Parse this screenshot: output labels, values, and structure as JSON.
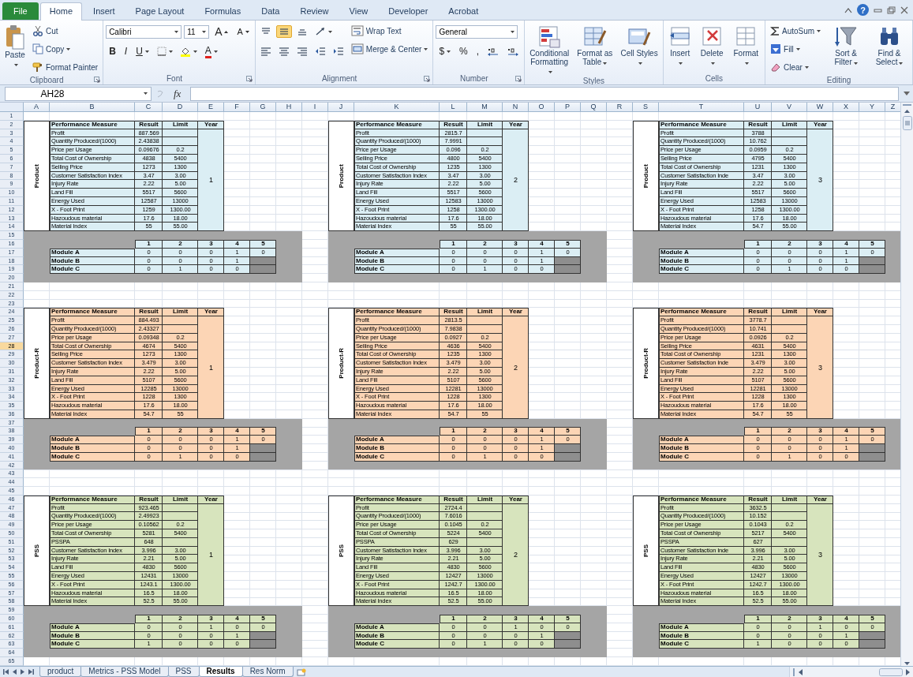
{
  "ribbon_tabs": [
    {
      "label": "File",
      "kind": "file",
      "selected": false
    },
    {
      "label": "Home",
      "kind": "tab",
      "selected": true
    },
    {
      "label": "Insert",
      "kind": "tab",
      "selected": false
    },
    {
      "label": "Page Layout",
      "kind": "tab",
      "selected": false
    },
    {
      "label": "Formulas",
      "kind": "tab",
      "selected": false
    },
    {
      "label": "Data",
      "kind": "tab",
      "selected": false
    },
    {
      "label": "Review",
      "kind": "tab",
      "selected": false
    },
    {
      "label": "View",
      "kind": "tab",
      "selected": false
    },
    {
      "label": "Developer",
      "kind": "tab",
      "selected": false
    },
    {
      "label": "Acrobat",
      "kind": "tab",
      "selected": false
    }
  ],
  "window_controls": {
    "help": "?"
  },
  "ribbon": {
    "groups": [
      {
        "label": "Clipboard",
        "launcher": true,
        "columns": [
          [
            {
              "kind": "large",
              "label": "Paste",
              "dropdown": true
            }
          ],
          [
            {
              "kind": "small",
              "label": "Cut",
              "dropdown": false
            },
            {
              "kind": "small",
              "label": "Copy",
              "dropdown": true
            },
            {
              "kind": "small",
              "label": "Format Painter",
              "dropdown": false
            }
          ]
        ]
      },
      {
        "label": "Font",
        "launcher": true,
        "columns": [
          [
            {
              "kind": "row",
              "items": [
                {
                  "kind": "font-combo",
                  "value": "Calibri"
                },
                {
                  "kind": "size-combo",
                  "value": "11"
                },
                {
                  "kind": "grow",
                  "label": "A"
                },
                {
                  "kind": "shrink",
                  "label": "A"
                }
              ]
            },
            {
              "kind": "row",
              "items": [
                {
                  "kind": "bold",
                  "label": "B",
                  "dropdown": false
                },
                {
                  "kind": "italic",
                  "label": "I",
                  "dropdown": false
                },
                {
                  "kind": "underline",
                  "label": "U",
                  "dropdown": true
                },
                {
                  "kind": "tool",
                  "dropdown": true
                },
                {
                  "kind": "tool",
                  "dropdown": true
                },
                {
                  "kind": "fontcolor",
                  "label": "A",
                  "dropdown": true
                }
              ]
            }
          ]
        ]
      },
      {
        "label": "Alignment",
        "launcher": true,
        "columns": [
          [
            {
              "kind": "row",
              "items": [
                {
                  "kind": "tool",
                  "dropdown": false,
                  "selected": false
                },
                {
                  "kind": "tool",
                  "dropdown": false,
                  "selected": true
                },
                {
                  "kind": "tool",
                  "dropdown": false,
                  "selected": false
                },
                {
                  "kind": "tool",
                  "dropdown": true
                }
              ]
            },
            {
              "kind": "row",
              "items": [
                {
                  "kind": "tool",
                  "dropdown": false,
                  "selected": false
                },
                {
                  "kind": "tool",
                  "dropdown": false,
                  "selected": false
                },
                {
                  "kind": "tool",
                  "dropdown": false,
                  "selected": false
                },
                {
                  "kind": "tool",
                  "dropdown": false
                },
                {
                  "kind": "tool",
                  "dropdown": false
                }
              ]
            }
          ],
          [
            {
              "kind": "small",
              "label": "Wrap Text",
              "dropdown": false
            },
            {
              "kind": "small",
              "label": "Merge & Center",
              "dropdown": true
            }
          ]
        ]
      },
      {
        "label": "Number",
        "launcher": true,
        "columns": [
          [
            {
              "kind": "row",
              "items": [
                {
                  "kind": "format-combo",
                  "value": "General"
                }
              ]
            },
            {
              "kind": "row",
              "items": [
                {
                  "kind": "key",
                  "label": "$",
                  "dropdown": true
                },
                {
                  "kind": "key",
                  "label": "%",
                  "dropdown": false
                },
                {
                  "kind": "key",
                  "label": ",",
                  "dropdown": false
                },
                {
                  "kind": "tool",
                  "dropdown": false
                },
                {
                  "kind": "tool",
                  "dropdown": false
                }
              ]
            }
          ]
        ]
      },
      {
        "label": "Styles",
        "launcher": false,
        "columns": [
          [
            {
              "kind": "large",
              "label": "Conditional Formatting",
              "dropdown": true
            }
          ],
          [
            {
              "kind": "large",
              "label": "Format as Table",
              "dropdown": true
            }
          ],
          [
            {
              "kind": "large",
              "label": "Cell Styles",
              "dropdown": true
            }
          ]
        ]
      },
      {
        "label": "Cells",
        "launcher": false,
        "columns": [
          [
            {
              "kind": "large",
              "label": "Insert",
              "dropdown": true
            }
          ],
          [
            {
              "kind": "large",
              "label": "Delete",
              "dropdown": true
            }
          ],
          [
            {
              "kind": "large",
              "label": "Format",
              "dropdown": true
            }
          ]
        ]
      },
      {
        "label": "Editing",
        "launcher": false,
        "columns": [
          [
            {
              "kind": "small",
              "label": "AutoSum",
              "dropdown": true
            },
            {
              "kind": "small",
              "label": "Fill",
              "dropdown": true
            },
            {
              "kind": "small",
              "label": "Clear",
              "dropdown": true
            }
          ],
          [
            {
              "kind": "large",
              "label": "Sort & Filter",
              "dropdown": true
            }
          ],
          [
            {
              "kind": "large",
              "label": "Find & Select",
              "dropdown": true
            }
          ]
        ]
      }
    ]
  },
  "formula_bar": {
    "name_box": "AH28",
    "function_label": "fx"
  },
  "sheet": {
    "columns": [
      "A",
      "B",
      "C",
      "D",
      "E",
      "F",
      "G",
      "H",
      "I",
      "J",
      "K",
      "L",
      "M",
      "N",
      "O",
      "P",
      "Q",
      "R",
      "S",
      "T",
      "U",
      "V",
      "W",
      "X",
      "Y",
      "Z"
    ],
    "rows": [
      {
        "label": "1",
        "selected": false
      },
      {
        "label": "2",
        "selected": false
      },
      {
        "label": "3",
        "selected": false
      },
      {
        "label": "4",
        "selected": false
      },
      {
        "label": "5",
        "selected": false
      },
      {
        "label": "6",
        "selected": false
      },
      {
        "label": "7",
        "selected": false
      },
      {
        "label": "8",
        "selected": false
      },
      {
        "label": "9",
        "selected": false
      },
      {
        "label": "10",
        "selected": false
      },
      {
        "label": "11",
        "selected": false
      },
      {
        "label": "12",
        "selected": false
      },
      {
        "label": "13",
        "selected": false
      },
      {
        "label": "14",
        "selected": false
      },
      {
        "label": "15",
        "selected": false
      },
      {
        "label": "16",
        "selected": false
      },
      {
        "label": "17",
        "selected": false
      },
      {
        "label": "18",
        "selected": false
      },
      {
        "label": "19",
        "selected": false
      },
      {
        "label": "20",
        "selected": false
      },
      {
        "label": "21",
        "selected": false
      },
      {
        "label": "22",
        "selected": false
      },
      {
        "label": "23",
        "selected": false
      },
      {
        "label": "24",
        "selected": false
      },
      {
        "label": "25",
        "selected": false
      },
      {
        "label": "26",
        "selected": false
      },
      {
        "label": "27",
        "selected": false
      },
      {
        "label": "28",
        "selected": true
      },
      {
        "label": "29",
        "selected": false
      },
      {
        "label": "30",
        "selected": false
      },
      {
        "label": "31",
        "selected": false
      },
      {
        "label": "32",
        "selected": false
      },
      {
        "label": "33",
        "selected": false
      },
      {
        "label": "34",
        "selected": false
      },
      {
        "label": "35",
        "selected": false
      },
      {
        "label": "36",
        "selected": false
      },
      {
        "label": "37",
        "selected": false
      },
      {
        "label": "38",
        "selected": false
      },
      {
        "label": "39",
        "selected": false
      },
      {
        "label": "40",
        "selected": false
      },
      {
        "label": "41",
        "selected": false
      },
      {
        "label": "42",
        "selected": false
      },
      {
        "label": "43",
        "selected": false
      },
      {
        "label": "44",
        "selected": false
      },
      {
        "label": "45",
        "selected": false
      },
      {
        "label": "46",
        "selected": false
      },
      {
        "label": "47",
        "selected": false
      },
      {
        "label": "48",
        "selected": false
      },
      {
        "label": "49",
        "selected": false
      },
      {
        "label": "50",
        "selected": false
      },
      {
        "label": "51",
        "selected": false
      },
      {
        "label": "52",
        "selected": false
      },
      {
        "label": "53",
        "selected": false
      },
      {
        "label": "54",
        "selected": false
      },
      {
        "label": "55",
        "selected": false
      },
      {
        "label": "56",
        "selected": false
      },
      {
        "label": "57",
        "selected": false
      },
      {
        "label": "58",
        "selected": false
      },
      {
        "label": "59",
        "selected": false
      },
      {
        "label": "60",
        "selected": false
      },
      {
        "label": "61",
        "selected": false
      },
      {
        "label": "62",
        "selected": false
      },
      {
        "label": "63",
        "selected": false
      },
      {
        "label": "64",
        "selected": false
      },
      {
        "label": "65",
        "selected": false
      }
    ],
    "blocks": [
      {
        "label": "Product",
        "color": "#dbeef4",
        "headers": [
          "Performance Measure",
          "Result",
          "Limit",
          "Year"
        ],
        "year": "1",
        "module_columns": [
          "1",
          "2",
          "3",
          "4",
          "5"
        ],
        "measures": [
          {
            "name": "Profit",
            "result": "887.569"
          },
          {
            "name": "Quantity Produced/(1000)",
            "result": "2.43838"
          },
          {
            "name": "Price per Usage",
            "result": "0.09676",
            "limit": "0.2"
          },
          {
            "name": "Total Cost of Ownership",
            "result": "4838",
            "limit": "5400"
          },
          {
            "name": "Selling Price",
            "result": "1273",
            "limit": "1300"
          },
          {
            "name": "Customer Satisfaction Index",
            "result": "3.47",
            "limit": "3.00"
          },
          {
            "name": "Injury Rate",
            "result": "2.22",
            "limit": "5.00"
          },
          {
            "name": "Land Fill",
            "result": "5517",
            "limit": "5600"
          },
          {
            "name": "Energy Used",
            "result": "12587",
            "limit": "13000"
          },
          {
            "name": "X - Foot Print",
            "result": "1259",
            "limit": "1300.00"
          },
          {
            "name": "Hazoudous material",
            "result": "17.6",
            "limit": "18.00"
          },
          {
            "name": "Material Index",
            "result": "55",
            "limit": "55.00"
          }
        ],
        "modules": [
          {
            "name": "Module A",
            "values": [
              "0",
              "0",
              "0",
              "1",
              "0"
            ]
          },
          {
            "name": "Module B",
            "values": [
              "0",
              "0",
              "0",
              "1"
            ]
          },
          {
            "name": "Module C",
            "values": [
              "0",
              "1",
              "0",
              "0"
            ]
          }
        ]
      },
      {
        "label": "Product",
        "color": "#dbeef4",
        "headers": [
          "Performance Measure",
          "Result",
          "Limit",
          "Year"
        ],
        "year": "2",
        "module_columns": [
          "1",
          "2",
          "3",
          "4",
          "5"
        ],
        "measures": [
          {
            "name": "Profit",
            "result": "2815.7"
          },
          {
            "name": "Quantity Produced/(1000)",
            "result": "7.9991"
          },
          {
            "name": "Price per Usage",
            "result": "0.096",
            "limit": "0.2"
          },
          {
            "name": "Selling Price",
            "result": "4800",
            "limit": "5400"
          },
          {
            "name": "Total Cost of Ownership",
            "result": "1235",
            "limit": "1300"
          },
          {
            "name": "Customer Satisfaction Index",
            "result": "3.47",
            "limit": "3.00"
          },
          {
            "name": "Injury Rate",
            "result": "2.22",
            "limit": "5.00"
          },
          {
            "name": "Land Fill",
            "result": "5517",
            "limit": "5600"
          },
          {
            "name": "Energy Used",
            "result": "12583",
            "limit": "13000"
          },
          {
            "name": "X - Foot Print",
            "result": "1258",
            "limit": "1300.00"
          },
          {
            "name": "Hazoudous material",
            "result": "17.6",
            "limit": "18.00"
          },
          {
            "name": "Material Index",
            "result": "55",
            "limit": "55.00"
          }
        ],
        "modules": [
          {
            "name": "Module A",
            "values": [
              "0",
              "0",
              "0",
              "1",
              "0"
            ]
          },
          {
            "name": "Module B",
            "values": [
              "0",
              "0",
              "0",
              "1"
            ]
          },
          {
            "name": "Module C",
            "values": [
              "0",
              "1",
              "0",
              "0"
            ]
          }
        ]
      },
      {
        "label": "Product",
        "color": "#dbeef4",
        "headers": [
          "Performance Measure",
          "Result",
          "Limit",
          "Year"
        ],
        "year": "3",
        "module_columns": [
          "1",
          "2",
          "3",
          "4",
          "5"
        ],
        "measures": [
          {
            "name": "Profit",
            "result": "3788"
          },
          {
            "name": "Quantity Produced/(1000)",
            "result": "10.762"
          },
          {
            "name": "Price per Usage",
            "result": "0.0959",
            "limit": "0.2"
          },
          {
            "name": "Selling Price",
            "result": "4795",
            "limit": "5400"
          },
          {
            "name": "Total Cost of Ownership",
            "result": "1231",
            "limit": "1300"
          },
          {
            "name": "Customer Satisfaction Inde",
            "result": "3.47",
            "limit": "3.00"
          },
          {
            "name": "Injury Rate",
            "result": "2.22",
            "limit": "5.00"
          },
          {
            "name": "Land Fill",
            "result": "5517",
            "limit": "5600"
          },
          {
            "name": "Energy Used",
            "result": "12583",
            "limit": "13000"
          },
          {
            "name": "X - Foot Print",
            "result": "1258",
            "limit": "1300.00"
          },
          {
            "name": "Hazoudous material",
            "result": "17.6",
            "limit": "18.00"
          },
          {
            "name": "Material Index",
            "result": "54.7",
            "limit": "55.00"
          }
        ],
        "modules": [
          {
            "name": "Module A",
            "values": [
              "0",
              "0",
              "0",
              "1",
              "0"
            ]
          },
          {
            "name": "Module B",
            "values": [
              "0",
              "0",
              "0",
              "1"
            ]
          },
          {
            "name": "Module C",
            "values": [
              "0",
              "1",
              "0",
              "0"
            ]
          }
        ]
      },
      {
        "label": "Product-R",
        "color": "#fcd5b5",
        "headers": [
          "Performance Measure",
          "Result",
          "Limit",
          "Year"
        ],
        "year": "1",
        "module_columns": [
          "1",
          "2",
          "3",
          "4",
          "5"
        ],
        "measures": [
          {
            "name": "Profit",
            "result": "884.493"
          },
          {
            "name": "Quantity Produced/(1000)",
            "result": "2.43327"
          },
          {
            "name": "Price per Usage",
            "result": "0.09348",
            "limit": "0.2"
          },
          {
            "name": "Total Cost of Ownership",
            "result": "4674",
            "limit": "5400"
          },
          {
            "name": "Selling Price",
            "result": "1273",
            "limit": "1300"
          },
          {
            "name": "Customer Satisfaction Index",
            "result": "3.479",
            "limit": "3.00"
          },
          {
            "name": "Injury Rate",
            "result": "2.22",
            "limit": "5.00"
          },
          {
            "name": "Land Fill",
            "result": "5107",
            "limit": "5600"
          },
          {
            "name": "Energy Used",
            "result": "12285",
            "limit": "13000"
          },
          {
            "name": "X - Foot Print",
            "result": "1228",
            "limit": "1300"
          },
          {
            "name": "Hazoudous material",
            "result": "17.6",
            "limit": "18.00"
          },
          {
            "name": "Material Index",
            "result": "54.7",
            "limit": "55"
          }
        ],
        "modules": [
          {
            "name": "Module A",
            "values": [
              "0",
              "0",
              "0",
              "1",
              "0"
            ]
          },
          {
            "name": "Module B",
            "values": [
              "0",
              "0",
              "0",
              "1"
            ]
          },
          {
            "name": "Module C",
            "values": [
              "0",
              "1",
              "0",
              "0"
            ]
          }
        ]
      },
      {
        "label": "Product-R",
        "color": "#fcd5b5",
        "headers": [
          "Performance Measure",
          "Result",
          "Limit",
          "Year"
        ],
        "year": "2",
        "module_columns": [
          "1",
          "2",
          "3",
          "4",
          "5"
        ],
        "measures": [
          {
            "name": "Profit",
            "result": "2813.5"
          },
          {
            "name": "Quantity Produced/(1000)",
            "result": "7.9838"
          },
          {
            "name": "Price per Usage",
            "result": "0.0927",
            "limit": "0.2"
          },
          {
            "name": "Selling Price",
            "result": "4636",
            "limit": "5400"
          },
          {
            "name": "Total Cost of Ownership",
            "result": "1235",
            "limit": "1300"
          },
          {
            "name": "Customer Satisfaction Index",
            "result": "3.479",
            "limit": "3.00"
          },
          {
            "name": "Injury Rate",
            "result": "2.22",
            "limit": "5.00"
          },
          {
            "name": "Land Fill",
            "result": "5107",
            "limit": "5600"
          },
          {
            "name": "Energy Used",
            "result": "12281",
            "limit": "13000"
          },
          {
            "name": "X - Foot Print",
            "result": "1228",
            "limit": "1300"
          },
          {
            "name": "Hazoudous material",
            "result": "17.6",
            "limit": "18.00"
          },
          {
            "name": "Material Index",
            "result": "54.7",
            "limit": "55"
          }
        ],
        "modules": [
          {
            "name": "Module A",
            "values": [
              "0",
              "0",
              "0",
              "1",
              "0"
            ]
          },
          {
            "name": "Module B",
            "values": [
              "0",
              "0",
              "0",
              "1"
            ]
          },
          {
            "name": "Module C",
            "values": [
              "0",
              "1",
              "0",
              "0"
            ]
          }
        ]
      },
      {
        "label": "Product-R",
        "color": "#fcd5b5",
        "headers": [
          "Performance Measure",
          "Result",
          "Limit",
          "Year"
        ],
        "year": "3",
        "module_columns": [
          "1",
          "2",
          "3",
          "4",
          "5"
        ],
        "measures": [
          {
            "name": "Profit",
            "result": "3778.7"
          },
          {
            "name": "Quantity Produced/(1000)",
            "result": "10.741"
          },
          {
            "name": "Price per Usage",
            "result": "0.0926",
            "limit": "0.2"
          },
          {
            "name": "Selling Price",
            "result": "4631",
            "limit": "5400"
          },
          {
            "name": "Total Cost of Ownership",
            "result": "1231",
            "limit": "1300"
          },
          {
            "name": "Customer Satisfaction Inde",
            "result": "3.479",
            "limit": "3.00"
          },
          {
            "name": "Injury Rate",
            "result": "2.22",
            "limit": "5.00"
          },
          {
            "name": "Land Fill",
            "result": "5107",
            "limit": "5600"
          },
          {
            "name": "Energy Used",
            "result": "12281",
            "limit": "13000"
          },
          {
            "name": "X - Foot Print",
            "result": "1228",
            "limit": "1300"
          },
          {
            "name": "Hazoudous material",
            "result": "17.6",
            "limit": "18.00"
          },
          {
            "name": "Material Index",
            "result": "54.7",
            "limit": "55"
          }
        ],
        "modules": [
          {
            "name": "Module A",
            "values": [
              "0",
              "0",
              "0",
              "1",
              "0"
            ]
          },
          {
            "name": "Module B",
            "values": [
              "0",
              "0",
              "0",
              "1"
            ]
          },
          {
            "name": "Module C",
            "values": [
              "0",
              "1",
              "0",
              "0"
            ]
          }
        ]
      },
      {
        "label": "PSS",
        "color": "#d7e4bd",
        "headers": [
          "Performance Measure",
          "Result",
          "Limit",
          "Year"
        ],
        "year": "1",
        "module_columns": [
          "1",
          "2",
          "3",
          "4",
          "5"
        ],
        "measures": [
          {
            "name": "Profit",
            "result": "923.465"
          },
          {
            "name": "Quantity Produced/(1000)",
            "result": "2.49923"
          },
          {
            "name": "Price per Usage",
            "result": "0.10562",
            "limit": "0.2"
          },
          {
            "name": "Total Cost of Ownership",
            "result": "5281",
            "limit": "5400"
          },
          {
            "name": "PSSPA",
            "result": "648"
          },
          {
            "name": "Customer Satisfaction Index",
            "result": "3.996",
            "limit": "3.00"
          },
          {
            "name": "Injury Rate",
            "result": "2.21",
            "limit": "5.00"
          },
          {
            "name": "Land Fill",
            "result": "4830",
            "limit": "5600"
          },
          {
            "name": "Energy Used",
            "result": "12431",
            "limit": "13000"
          },
          {
            "name": "X - Foot Print",
            "result": "1243.1",
            "limit": "1300.00"
          },
          {
            "name": "Hazoudous material",
            "result": "16.5",
            "limit": "18.00"
          },
          {
            "name": "Material Index",
            "result": "52.5",
            "limit": "55.00"
          }
        ],
        "modules": [
          {
            "name": "Module A",
            "values": [
              "0",
              "0",
              "1",
              "0",
              "0"
            ]
          },
          {
            "name": "Module B",
            "values": [
              "0",
              "0",
              "0",
              "1"
            ]
          },
          {
            "name": "Module C",
            "values": [
              "1",
              "0",
              "0",
              "0"
            ]
          }
        ]
      },
      {
        "label": "PSS",
        "color": "#d7e4bd",
        "headers": [
          "Performance Measure",
          "Result",
          "Limit",
          "Year"
        ],
        "year": "2",
        "module_columns": [
          "1",
          "2",
          "3",
          "4",
          "5"
        ],
        "measures": [
          {
            "name": "Profit",
            "result": "2724.4"
          },
          {
            "name": "Quantity Produced/(1000)",
            "result": "7.6016"
          },
          {
            "name": "Price per Usage",
            "result": "0.1045",
            "limit": "0.2"
          },
          {
            "name": "Total Cost of Ownership",
            "result": "5224",
            "limit": "5400"
          },
          {
            "name": "PSSPA",
            "result": "629"
          },
          {
            "name": "Customer Satisfaction Index",
            "result": "3.996",
            "limit": "3.00"
          },
          {
            "name": "Injury Rate",
            "result": "2.21",
            "limit": "5.00"
          },
          {
            "name": "Land Fill",
            "result": "4830",
            "limit": "5600"
          },
          {
            "name": "Energy Used",
            "result": "12427",
            "limit": "13000"
          },
          {
            "name": "X - Foot Print",
            "result": "1242.7",
            "limit": "1300.00"
          },
          {
            "name": "Hazoudous material",
            "result": "16.5",
            "limit": "18.00"
          },
          {
            "name": "Material Index",
            "result": "52.5",
            "limit": "55.00"
          }
        ],
        "modules": [
          {
            "name": "Module A",
            "values": [
              "0",
              "0",
              "1",
              "0",
              "0"
            ]
          },
          {
            "name": "Module B",
            "values": [
              "0",
              "0",
              "0",
              "1"
            ]
          },
          {
            "name": "Module C",
            "values": [
              "0",
              "1",
              "0",
              "0"
            ]
          }
        ]
      },
      {
        "label": "PSS",
        "color": "#d7e4bd",
        "headers": [
          "Performance Measure",
          "Result",
          "Limit",
          "Year"
        ],
        "year": "3",
        "module_columns": [
          "1",
          "2",
          "3",
          "4",
          "5"
        ],
        "measures": [
          {
            "name": "Profit",
            "result": "3632.5"
          },
          {
            "name": "Quantity Produced/(1000)",
            "result": "10.152"
          },
          {
            "name": "Price per Usage",
            "result": "0.1043",
            "limit": "0.2"
          },
          {
            "name": "Total Cost of Ownership",
            "result": "5217",
            "limit": "5400"
          },
          {
            "name": "PSSPA",
            "result": "627"
          },
          {
            "name": "Customer Satisfaction Inde",
            "result": "3.996",
            "limit": "3.00"
          },
          {
            "name": "Injury Rate",
            "result": "2.21",
            "limit": "5.00"
          },
          {
            "name": "Land Fill",
            "result": "4830",
            "limit": "5600"
          },
          {
            "name": "Energy Used",
            "result": "12427",
            "limit": "13000"
          },
          {
            "name": "X - Foot Print",
            "result": "1242.7",
            "limit": "1300.00"
          },
          {
            "name": "Hazoudous material",
            "result": "16.5",
            "limit": "18.00"
          },
          {
            "name": "Material Index",
            "result": "52.5",
            "limit": "55.00"
          }
        ],
        "modules": [
          {
            "name": "Module A",
            "values": [
              "0",
              "0",
              "1",
              "0",
              "0"
            ]
          },
          {
            "name": "Module B",
            "values": [
              "0",
              "0",
              "0",
              "1"
            ]
          },
          {
            "name": "Module C",
            "values": [
              "1",
              "0",
              "0",
              "0"
            ]
          }
        ]
      }
    ]
  },
  "sheet_tabs": [
    {
      "label": "product",
      "selected": false
    },
    {
      "label": "Metrics - PSS Model",
      "selected": false
    },
    {
      "label": "PSS",
      "selected": false
    },
    {
      "label": "Results",
      "selected": true
    },
    {
      "label": "Res Norm",
      "selected": false
    }
  ]
}
